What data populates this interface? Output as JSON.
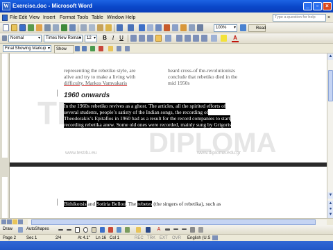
{
  "window": {
    "title": "Exercise.doc - Microsoft Word",
    "icon_label": "W"
  },
  "menu": {
    "items": [
      "File",
      "Edit",
      "View",
      "Insert",
      "Format",
      "Tools",
      "Table",
      "Window",
      "Help"
    ],
    "ask_placeholder": "Type a question for help"
  },
  "formatting": {
    "style": "Normal",
    "font": "Times New Roman",
    "size": "12",
    "zoom": "100%",
    "read_label": "Read",
    "bold": "B",
    "italic": "I",
    "underline": "U"
  },
  "reviewing": {
    "display": "Final Showing Markup",
    "show": "Show"
  },
  "document": {
    "top_left_lines": [
      "representing the rebetiko style, are",
      "alive and try to make a living with",
      "difficulty.  Markos Vamvakaris"
    ],
    "top_right_lines": [
      "heard cross-of the-revolutionists",
      "conclude that rebetiko died in the",
      "mid 1950s"
    ],
    "heading": "1960 onwards",
    "selected_lines": [
      "In the 1960s rebetiko revives as a ghost. The articles, all the spirited efforts of",
      "several students, people’s satisty of the Indian songs, the recording of",
      "Theodorakis’s Epitafios in 1960 had as a result for the record companies to start",
      "recording rebetika anew. Some old ones were recorded, mainly sung by Grigoris"
    ],
    "page2_line_parts": [
      {
        "text": "Bithikotsis",
        "sel": true
      },
      {
        "text": " and ",
        "sel": false
      },
      {
        "text": "Sotiria Bellou",
        "sel": true
      },
      {
        "text": ". The ",
        "sel": false
      },
      {
        "text": "rebetes",
        "sel": true
      },
      {
        "text": " (the singers of rebetika), such as",
        "sel": false
      }
    ],
    "watermark": {
      "brand": "TEST4U",
      "diploma": "DIPLOMA",
      "url_left": "www.test4u.eu",
      "url_right": "www.diploma.edu.gr"
    }
  },
  "drawing": {
    "draw_label": "Draw",
    "autoshapes_label": "AutoShapes"
  },
  "status": {
    "page": "Page 2",
    "sec": "Sec 1",
    "pos": "2/4",
    "at": "At 4.1\"",
    "ln": "Ln 16",
    "col": "Col 1",
    "rec": "REC",
    "trk": "TRK",
    "ext": "EXT",
    "ovr": "OVR",
    "lang": "English (U.S"
  },
  "colors": {
    "titlebar": "#0a47c9",
    "menubar": "#ece9d8",
    "selection": "#000000",
    "watermark": "#e6e6e6"
  }
}
